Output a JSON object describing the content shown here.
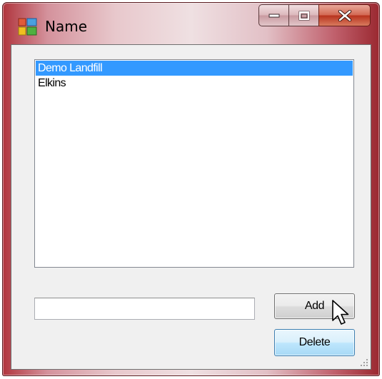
{
  "window": {
    "title": "Name",
    "icon": "app-window-icon",
    "caption_buttons": [
      "minimize-icon",
      "maximize-icon",
      "close-icon"
    ]
  },
  "listbox": {
    "items": [
      {
        "label": "Demo Landfill",
        "selected": true
      },
      {
        "label": "Elkins",
        "selected": false
      }
    ]
  },
  "name_input": {
    "value": ""
  },
  "buttons": {
    "add_label": "Add",
    "delete_label": "Delete"
  },
  "colors": {
    "selection": "#3399ff",
    "titlebar_accent": "#b0343c",
    "close_button": "#c8402a"
  }
}
